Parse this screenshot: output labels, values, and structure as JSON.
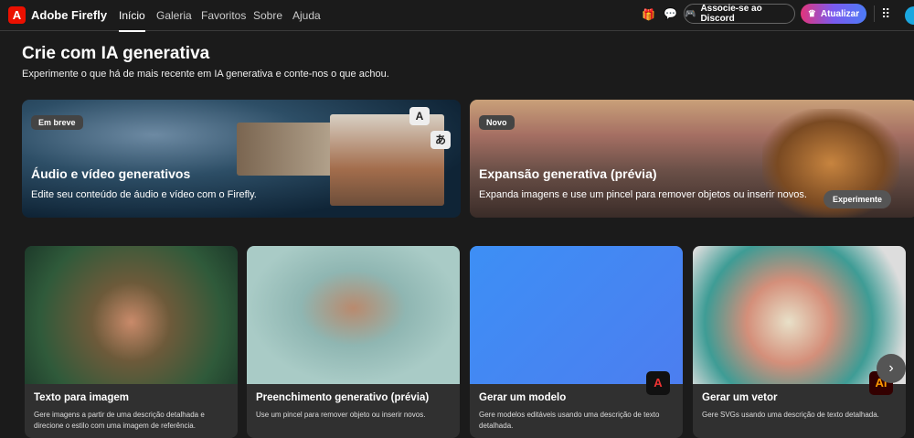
{
  "nav": {
    "brand": "Adobe Firefly",
    "links": [
      "Início",
      "Galeria",
      "Favoritos",
      "Sobre",
      "Ajuda"
    ],
    "discord": "Associe-se ao Discord",
    "upgrade": "Atualizar"
  },
  "hero": {
    "title": "Crie com IA generativa",
    "subtitle": "Experimente o que há de mais recente em IA generativa e conte-nos o que achou."
  },
  "banners": [
    {
      "badge": "Em breve",
      "title": "Áudio e vídeo generativos",
      "desc": "Edite seu conteúdo de áudio e vídeo com o Firefly.",
      "chips": [
        "A",
        "あ"
      ]
    },
    {
      "badge": "Novo",
      "title": "Expansão generativa (prévia)",
      "desc": "Expanda imagens e use um pincel para remover objetos ou inserir novos.",
      "button": "Experimente"
    }
  ],
  "cards": [
    {
      "title": "Texto para imagem",
      "desc": "Gere imagens a partir de uma descrição detalhada e direcione o estilo com uma imagem de referência."
    },
    {
      "title": "Preenchimento generativo (prévia)",
      "desc": "Use um pincel para remover objeto ou inserir novos."
    },
    {
      "title": "Gerar um modelo",
      "desc": "Gere modelos editáveis usando uma descrição de texto detalhada."
    },
    {
      "title": "Gerar um vetor",
      "desc": "Gere SVGs usando uma descrição de texto detalhada."
    }
  ]
}
